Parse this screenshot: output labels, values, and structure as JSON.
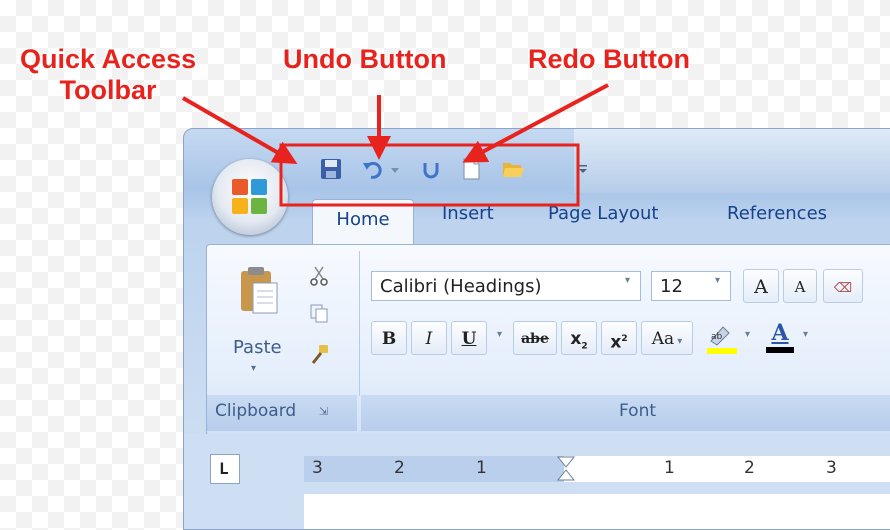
{
  "annotations": {
    "quick_access": "Quick Access\nToolbar",
    "undo": "Undo Button",
    "redo": "Redo Button",
    "color": "#e8231e"
  },
  "qat": {
    "icons": [
      "save-icon",
      "undo-icon",
      "dropdown-arrow-icon",
      "redo-icon",
      "new-document-icon",
      "open-folder-icon",
      "customize-dropdown-icon"
    ]
  },
  "tabs": [
    "Home",
    "Insert",
    "Page Layout",
    "References"
  ],
  "clipboard": {
    "paste_label": "Paste",
    "group_label": "Clipboard"
  },
  "font": {
    "font_name": "Calibri (Headings)",
    "font_size": "12",
    "grow_label": "A",
    "shrink_label": "A",
    "bold": "B",
    "italic": "I",
    "underline": "U",
    "strikethrough": "abe",
    "subscript": "x",
    "superscript": "x",
    "change_case": "Aa",
    "font_color_label": "A",
    "group_label": "Font"
  },
  "ruler": {
    "numbers": [
      "3",
      "2",
      "1",
      "1",
      "2",
      "3"
    ]
  }
}
